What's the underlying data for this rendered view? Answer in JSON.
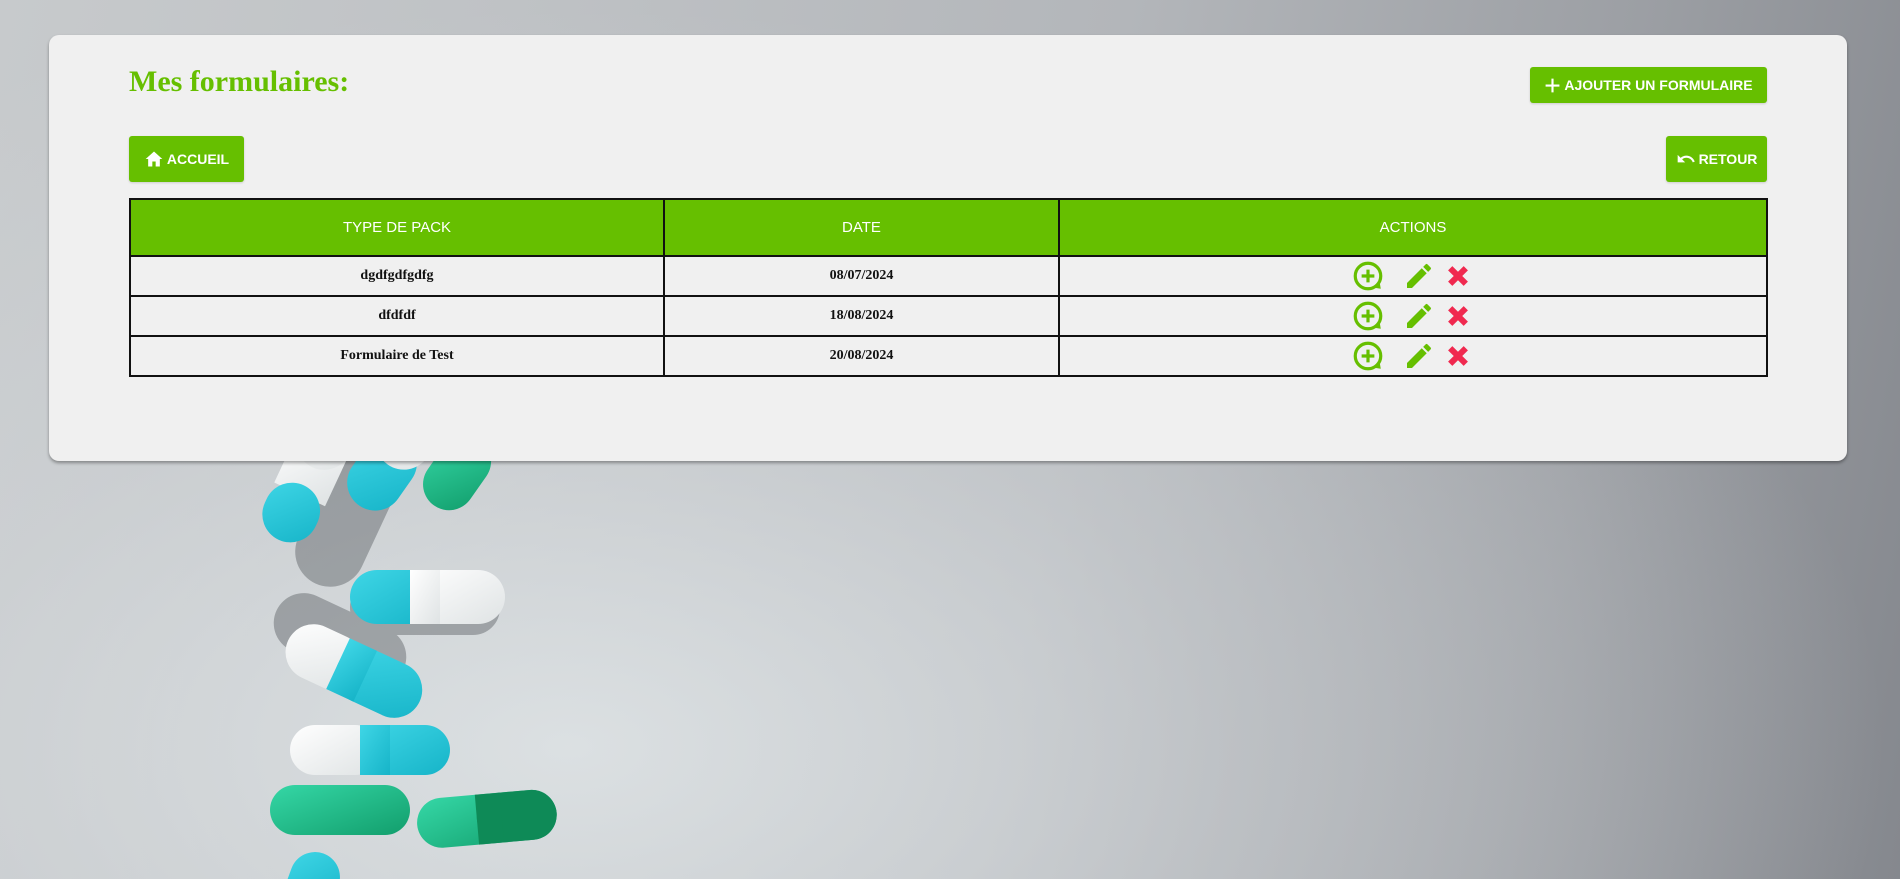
{
  "page": {
    "title": "Mes formulaires:"
  },
  "buttons": {
    "add_label": "AJOUTER UN FORMULAIRE",
    "home_label": "ACCUEIL",
    "back_label": "RETOUR"
  },
  "table": {
    "headers": [
      "TYPE DE PACK",
      "DATE",
      "ACTIONS"
    ],
    "rows": [
      {
        "type": "dgdfgdfgdfg",
        "date": "08/07/2024"
      },
      {
        "type": "dfdfdf",
        "date": "18/08/2024"
      },
      {
        "type": "Formulaire de Test",
        "date": "20/08/2024"
      }
    ],
    "row_actions": [
      "add-icon",
      "edit-icon",
      "delete-icon"
    ]
  },
  "icons": {
    "add": "plus-icon",
    "home": "home-icon",
    "back": "undo-icon"
  },
  "colors": {
    "accent": "#66bf00",
    "delete": "#f0294f",
    "panel": "#f0f0f0"
  }
}
